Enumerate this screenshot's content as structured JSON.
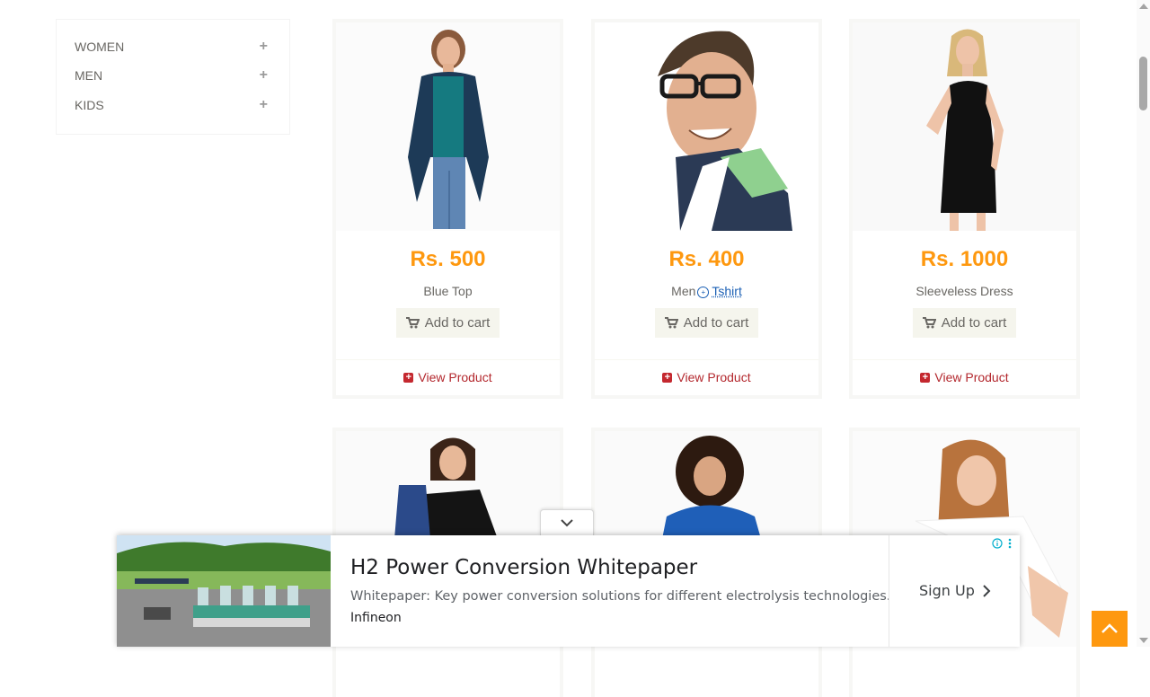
{
  "sidebar": {
    "categories": [
      {
        "label": "WOMEN",
        "icon": "plus-icon"
      },
      {
        "label": "MEN",
        "icon": "plus-icon"
      },
      {
        "label": "KIDS",
        "icon": "plus-icon"
      }
    ]
  },
  "products": [
    {
      "price": "Rs. 500",
      "name": "Blue Top",
      "cart_label": "Add to cart",
      "view_label": "View Product"
    },
    {
      "price": "Rs. 400",
      "name_prefix": "Men",
      "name_link": "Tshirt",
      "cart_label": "Add to cart",
      "view_label": "View Product"
    },
    {
      "price": "Rs. 1000",
      "name": "Sleeveless Dress",
      "cart_label": "Add to cart",
      "view_label": "View Product"
    }
  ],
  "ad": {
    "title": "H2 Power Conversion Whitepaper",
    "description": "Whitepaper: Key power conversion solutions for different electrolysis technologies.",
    "brand": "Infineon",
    "cta": "Sign Up"
  },
  "colors": {
    "accent": "#fe980f",
    "view_red": "#b3272d"
  }
}
